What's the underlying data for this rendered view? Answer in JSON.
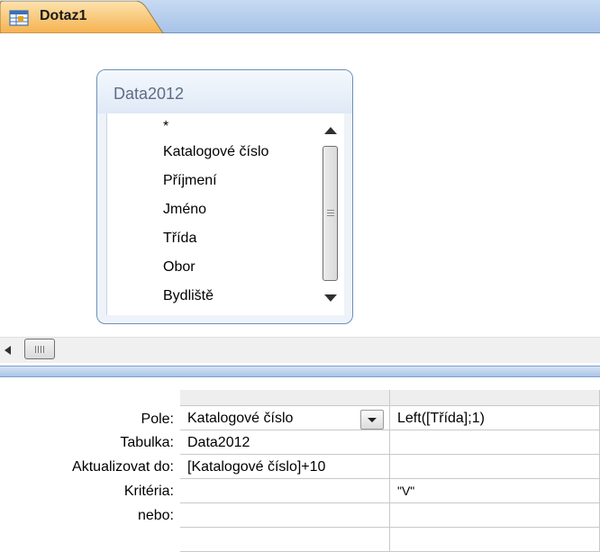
{
  "tab": {
    "title": "Dotaz1",
    "icon": "query-icon"
  },
  "table_box": {
    "title": "Data2012",
    "fields": [
      "*",
      "Katalogové číslo",
      "Příjmení",
      "Jméno",
      "Třída",
      "Obor",
      "Bydliště"
    ]
  },
  "grid": {
    "row_labels": {
      "field": "Pole:",
      "table": "Tabulka:",
      "update_to": "Aktualizovat do:",
      "criteria": "Kritéria:",
      "or": "nebo:"
    },
    "columns": [
      {
        "field": "Katalogové číslo",
        "table": "Data2012",
        "update_to": "[Katalogové číslo]+10",
        "criteria": "",
        "or": ""
      },
      {
        "field": "Left([Třída];1)",
        "table": "",
        "update_to": "",
        "criteria": "\"V\"",
        "or": ""
      }
    ]
  },
  "colors": {
    "tab_active": "#f9c46b",
    "accent": "#a7c3e8",
    "table_border": "#6f8fb9"
  }
}
